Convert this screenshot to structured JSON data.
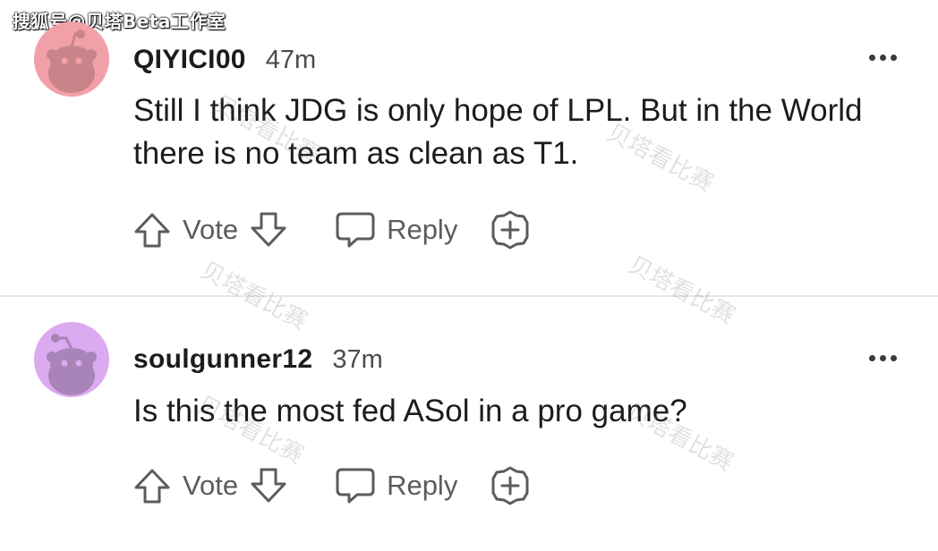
{
  "source_tag": "搜狐号@贝塔Beta工作室",
  "watermark_text": "贝塔看比赛",
  "comments": [
    {
      "username": "QIYICI00",
      "age": "47m",
      "body": "Still I think JDG is only hope of LPL. But in the World there is no team as clean as T1.",
      "vote_label": "Vote",
      "reply_label": "Reply",
      "avatar_color": "#f2a0a8",
      "avatar_body_color": "#c9848a"
    },
    {
      "username": "soulgunner12",
      "age": "37m",
      "body": "Is this the most fed ASol in a pro game?",
      "vote_label": "Vote",
      "reply_label": "Reply",
      "avatar_color": "#dcaaf0",
      "avatar_body_color": "#a884b8"
    }
  ],
  "icons": {
    "upvote": "upvote-arrow-icon",
    "downvote": "downvote-arrow-icon",
    "reply": "speech-bubble-icon",
    "award": "award-plus-icon",
    "more": "more-options-dots-icon",
    "avatar": "snoo-avatar-icon"
  }
}
